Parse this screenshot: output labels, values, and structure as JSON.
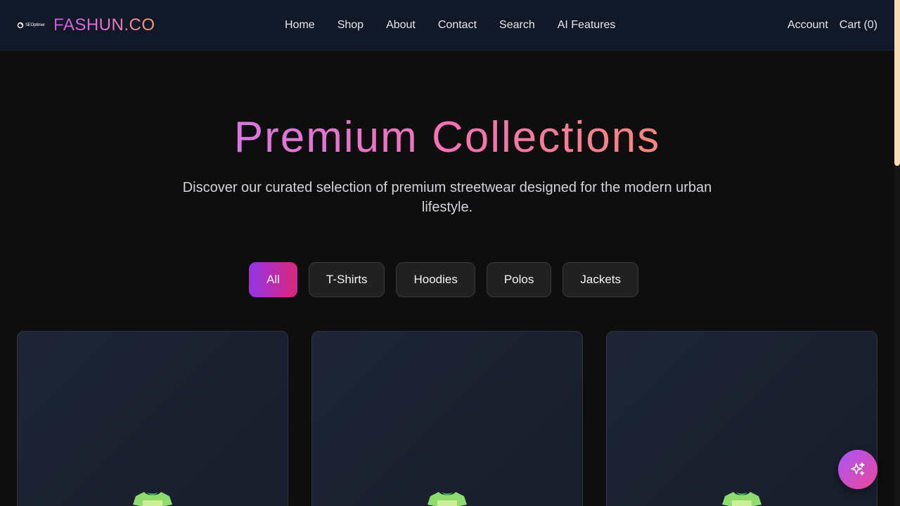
{
  "header": {
    "logo_text": "SEOptimer",
    "brand": "FASHUN.CO",
    "nav": [
      "Home",
      "Shop",
      "About",
      "Contact",
      "Search",
      "AI Features"
    ],
    "account": "Account",
    "cart": "Cart (0)"
  },
  "hero": {
    "title": "Premium Collections",
    "subtitle": "Discover our curated selection of premium streetwear designed for the modern urban lifestyle."
  },
  "filters": [
    {
      "label": "All",
      "active": true
    },
    {
      "label": "T-Shirts",
      "active": false
    },
    {
      "label": "Hoodies",
      "active": false
    },
    {
      "label": "Polos",
      "active": false
    },
    {
      "label": "Jackets",
      "active": false
    }
  ],
  "products": [
    {
      "icon": "tshirt-icon"
    },
    {
      "icon": "tshirt-icon"
    },
    {
      "icon": "tshirt-icon"
    }
  ],
  "fab": {
    "icon": "sparkles-icon"
  },
  "colors": {
    "background": "#0e0e0f",
    "header": "#111827",
    "accent_start": "#9333ea",
    "accent_end": "#db2777",
    "card": "#1e2535"
  }
}
